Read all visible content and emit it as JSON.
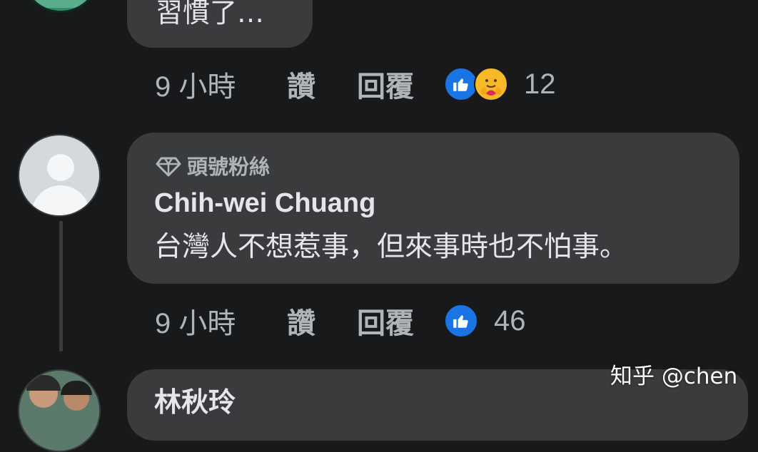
{
  "comments": [
    {
      "text": "習慣了…",
      "actions": {
        "time": "9 小時",
        "like_label": "讚",
        "reply_label": "回覆",
        "reactions": [
          "like-icon",
          "care-icon"
        ],
        "reaction_count": "12"
      }
    },
    {
      "badge": "頭號粉絲",
      "badge_icon": "diamond-icon",
      "author": "Chih-wei Chuang",
      "text": "台灣人不想惹事，但來事時也不怕事。",
      "actions": {
        "time": "9 小時",
        "like_label": "讚",
        "reply_label": "回覆",
        "reactions": [
          "like-icon"
        ],
        "reaction_count": "46"
      }
    },
    {
      "author": "林秋玲"
    }
  ],
  "watermark": "知乎 @chen",
  "colors": {
    "background": "#18191a",
    "bubble": "#3a3b3c",
    "primary_text": "#e4e6eb",
    "secondary_text": "#b0b3b8",
    "like_blue": "#1b74e4",
    "care_yellow": "#f7b928"
  }
}
